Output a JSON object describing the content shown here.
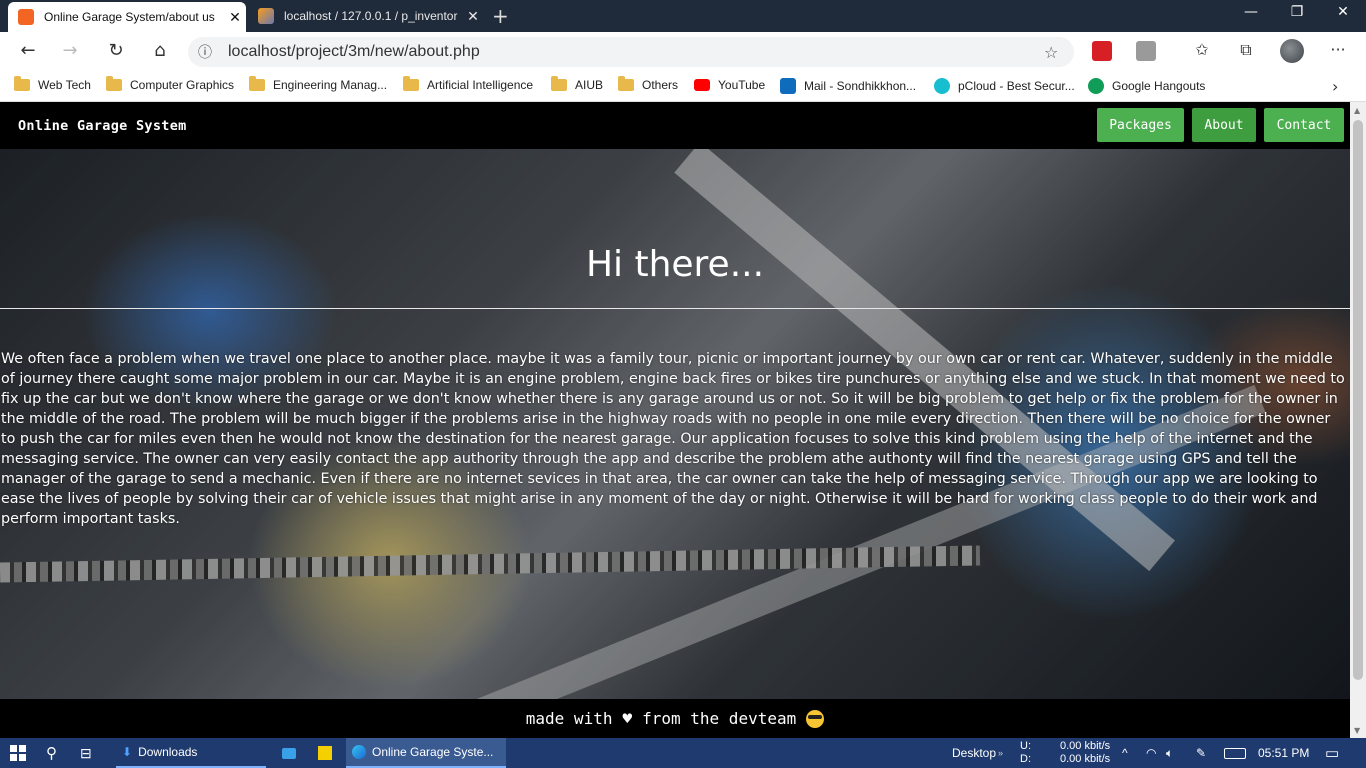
{
  "browser": {
    "tabs": [
      {
        "title": "Online Garage System/about us",
        "active": true
      },
      {
        "title": "localhost / 127.0.0.1 / p_inventor",
        "active": false
      }
    ],
    "new_tab": "+",
    "close": "✕",
    "window_controls": {
      "minimize": "—",
      "restore": "❐",
      "close": "✕"
    },
    "url": "localhost/project/3m/new/about.php",
    "nav": {
      "back": "←",
      "forward": "→",
      "reload": "↻",
      "home": "⌂"
    },
    "address_icons": {
      "info": "ⓘ",
      "favorite": "☆"
    },
    "toolbar_icons": {
      "favorites": "✩",
      "collections": "⧉",
      "more": "···"
    },
    "bookmarks": [
      {
        "label": "Web Tech",
        "icon": "folder-icon"
      },
      {
        "label": "Computer Graphics",
        "icon": "folder-icon"
      },
      {
        "label": "Engineering Manag...",
        "icon": "folder-icon"
      },
      {
        "label": "Artificial Intelligence",
        "icon": "folder-icon"
      },
      {
        "label": "AIUB",
        "icon": "folder-icon"
      },
      {
        "label": "Others",
        "icon": "folder-icon"
      },
      {
        "label": "YouTube",
        "icon": "youtube-icon"
      },
      {
        "label": "Mail - Sondhikkhon...",
        "icon": "outlook-icon"
      },
      {
        "label": "pCloud - Best Secur...",
        "icon": "pcloud-icon"
      },
      {
        "label": "Google Hangouts",
        "icon": "hangouts-icon"
      }
    ],
    "bookmarks_more": "›"
  },
  "page": {
    "brand": "Online Garage System",
    "nav": [
      {
        "label": "Packages"
      },
      {
        "label": "About",
        "active": true
      },
      {
        "label": "Contact"
      }
    ],
    "headline": "Hi there...",
    "about": "We often face a problem when we travel one place to another place. maybe it was a family tour, picnic or important journey by our own car or rent car. Whatever, suddenly in the middle of journey there caught some major problem in our car. Maybe it is an engine problem, engine back fires or bikes tire punchures or anything else and we stuck. In that moment we need to fix up the car but we don't know where the garage or we don't know whether there is any garage around us or not. So it will be big problem to get help or fix the problem for the owner in the middle of the road. The problem will be much bigger if the problems arise in the highway roads with no people in one mile every direction. Then there will be no choice for the owner to push the car for miles even then he would not know the destination for the nearest garage. Our application focuses to solve this kind problem using the help of the internet and the messaging service. The owner can very easily contact the app authority through the app and describe the problem athe authonty will find the nearest garage using GPS and tell the manager of the garage to send a mechanic. Even if there are no internet sevices in that area, the car owner can take the help of messaging service. Through our app we are looking to ease the lives of people by solving their car of vehicle issues that might arise in any moment of the day or night. Otherwise it will be hard for working class people to do their work and perform important tasks.",
    "footer": {
      "before": "made with",
      "heart": "♥",
      "after": "from the devteam"
    }
  },
  "taskbar": {
    "downloads": "Downloads",
    "browser_task": "Online Garage Syste...",
    "desktop": "Desktop",
    "net_up_label": "U:",
    "net_down_label": "D:",
    "net_up": "0.00 kbit/s",
    "net_down": "0.00 kbit/s",
    "time": "05:51 PM"
  },
  "colors": {
    "nav_button": "#4caf50",
    "taskbar": "#1e3a6e",
    "tabbar": "#1f2b3a"
  }
}
